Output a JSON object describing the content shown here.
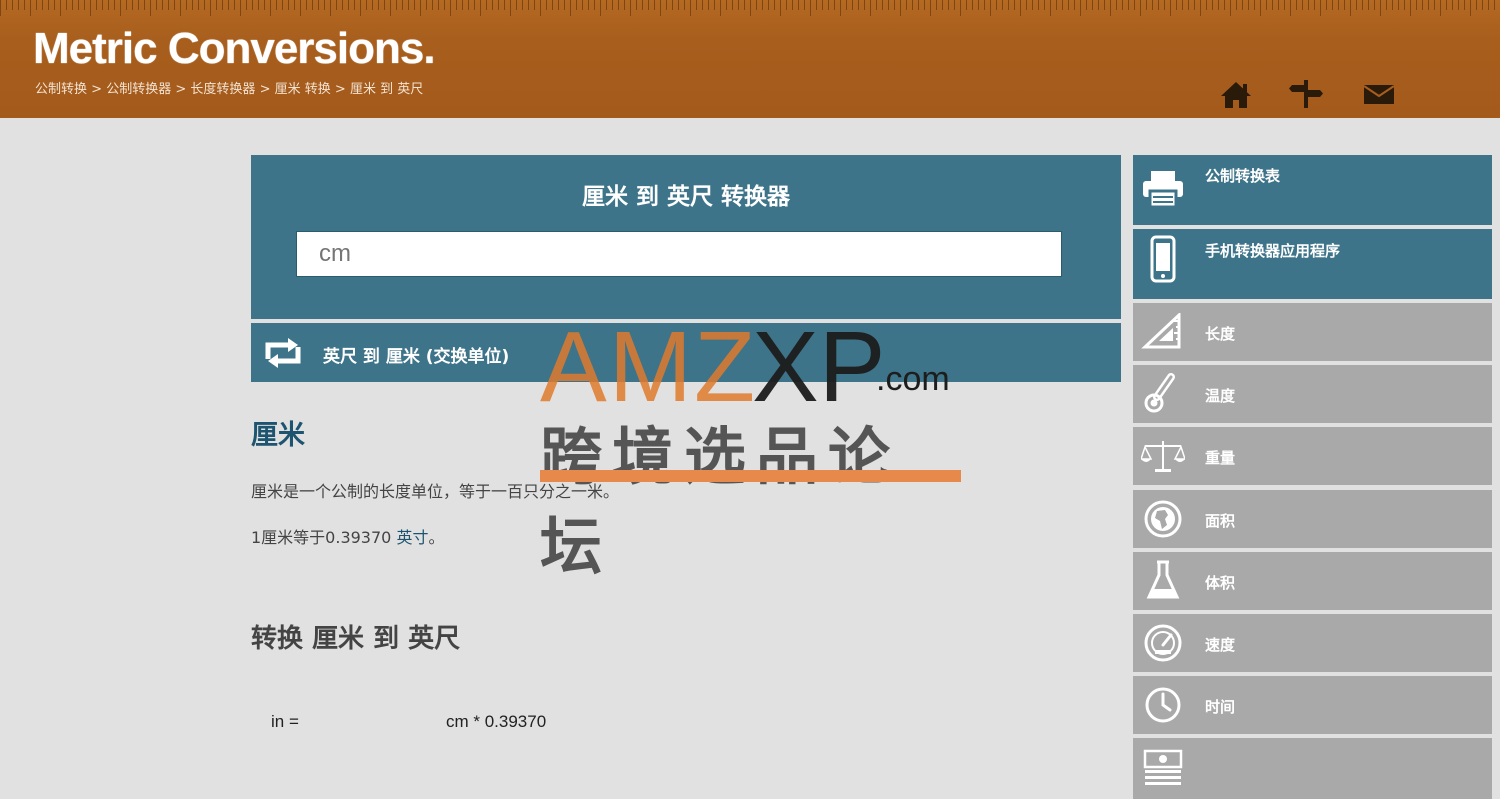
{
  "header": {
    "logo": "Metric Conversions.",
    "breadcrumb": [
      "公制转换",
      "公制转换器",
      "长度转换器",
      "厘米 转换",
      "厘米 到 英尺"
    ],
    "breadcrumb_separator": ">",
    "icons": [
      "home-icon",
      "signpost-icon",
      "mail-icon"
    ]
  },
  "converter": {
    "title": "厘米 到 英尺 转换器",
    "input_placeholder": "cm",
    "swap_label": "英尺 到 厘米 (交换单位)"
  },
  "content": {
    "heading": "厘米",
    "para1": "厘米是一个公制的长度单位，等于一百只分之一米。",
    "para2_prefix": "1厘米等于0.39370 ",
    "para2_link": "英寸",
    "para2_suffix": "。",
    "heading2": "转换 厘米 到 英尺",
    "formula_left": "in =",
    "formula_right": "cm * 0.39370"
  },
  "sidebar": {
    "items": [
      {
        "label": "公制转换表",
        "icon": "printer-icon"
      },
      {
        "label": "手机转换器应用程序",
        "icon": "mobile-phone-icon"
      },
      {
        "label": "长度",
        "icon": "ruler-triangle-icon"
      },
      {
        "label": "温度",
        "icon": "thermometer-icon"
      },
      {
        "label": "重量",
        "icon": "scales-icon"
      },
      {
        "label": "面积",
        "icon": "globe-icon"
      },
      {
        "label": "体积",
        "icon": "flask-icon"
      },
      {
        "label": "速度",
        "icon": "speedometer-icon"
      },
      {
        "label": "时间",
        "icon": "clock-icon"
      },
      {
        "label": "",
        "icon": "money-icon"
      }
    ]
  },
  "watermark": {
    "brand_a": "AMZ",
    "brand_b": "XP",
    "domain": ".com",
    "subtitle": "跨境选品论坛"
  },
  "colors": {
    "header": "#a85e1d",
    "panel": "#3d7489",
    "sidebar_gray": "#a9a9a9",
    "background": "#e1e1e1",
    "link": "#1d5470"
  }
}
